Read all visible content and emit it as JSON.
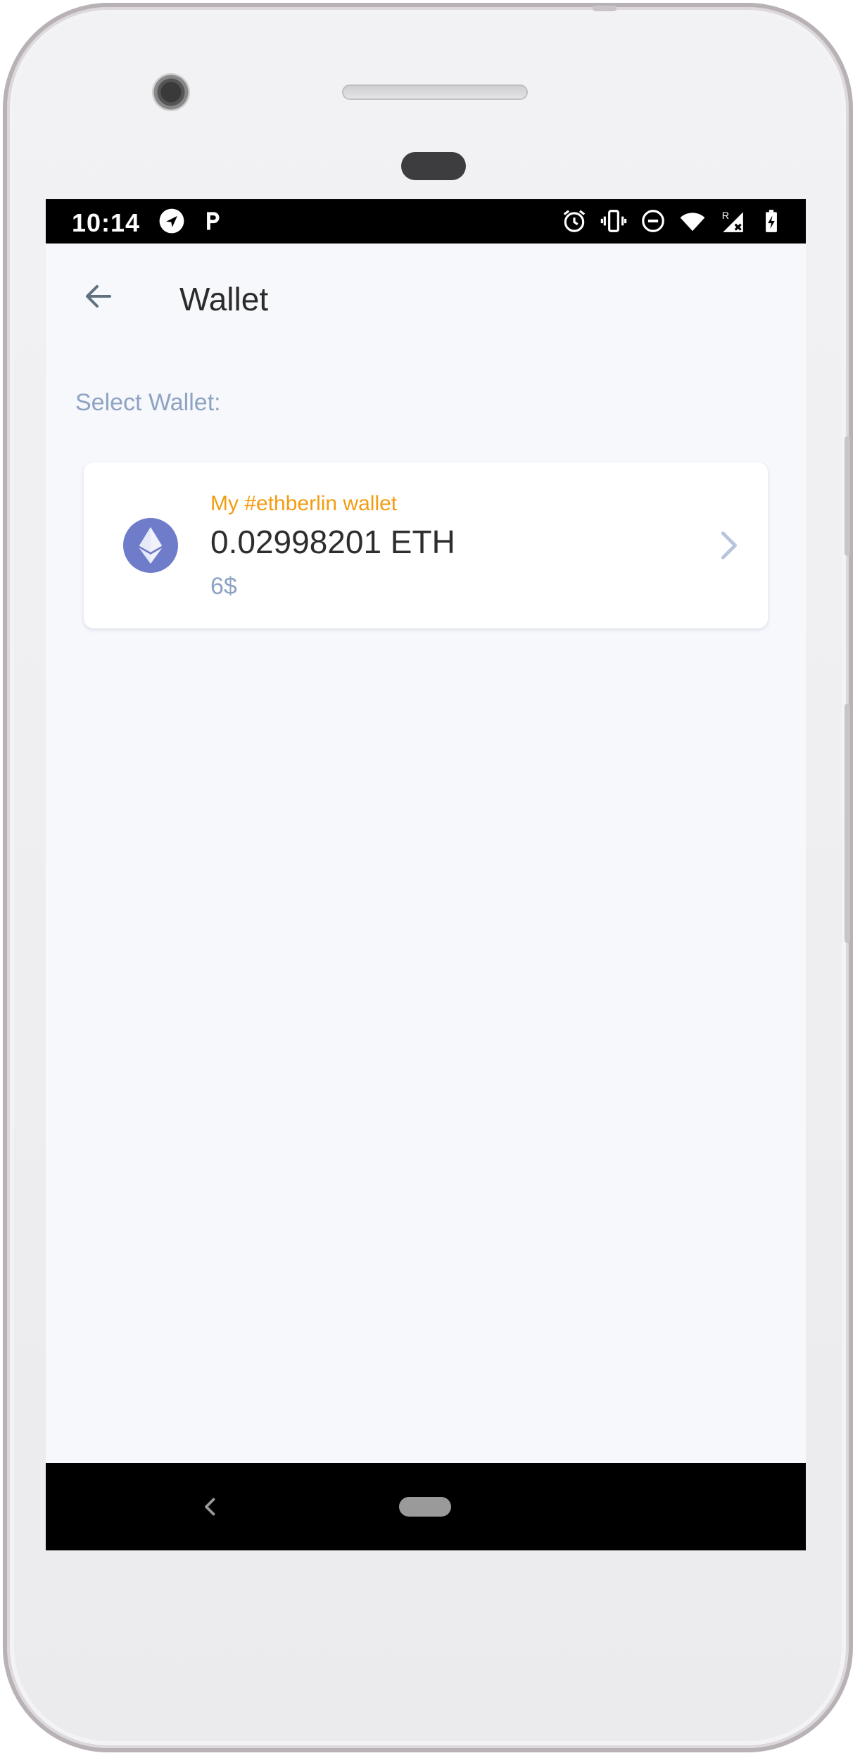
{
  "status_bar": {
    "time": "10:14",
    "left_icons": [
      "navigation-icon",
      "parking-icon"
    ],
    "right_icons": [
      "alarm-icon",
      "vibrate-icon",
      "do-not-disturb-icon",
      "wifi-icon",
      "signal-roaming-icon",
      "battery-charging-icon"
    ],
    "signal_badge": "R"
  },
  "app_bar": {
    "title": "Wallet",
    "back_icon": "arrow-left-icon"
  },
  "content": {
    "section_label": "Select Wallet:",
    "wallets": [
      {
        "name": "My #ethberlin wallet",
        "balance": "0.02998201 ETH",
        "fiat": "6$",
        "icon": "ethereum-icon"
      }
    ]
  },
  "nav_bar": {
    "back_icon": "nav-back-icon",
    "home_icon": "nav-home-icon"
  },
  "colors": {
    "accent_orange": "#f39c12",
    "muted_blue": "#8ea3c4",
    "eth_purple": "#6f7cca",
    "screen_bg": "#f7f8fc"
  }
}
